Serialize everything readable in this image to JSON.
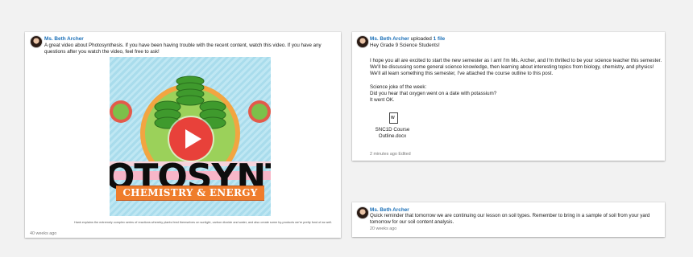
{
  "post_video": {
    "author": "Ms. Beth Archer",
    "body_lines": [
      "A great video about Photosynthesis. If you have been having trouble with the recent content, watch this video. If you have any",
      "questions after you watch the video, feel free to ask!"
    ],
    "thumbnail": {
      "big_word": "OTOSYNTHE",
      "ribbon": "CHEMISTRY & ENERGY"
    },
    "video_caption": "Hank explains the extremely complex series of reactions whereby plants feed themselves on sunlight, carbon dioxide and water, and also create some by-products we're pretty fond of as well.",
    "time": "40 weeks ago"
  },
  "post_file": {
    "author": "Ms. Beth Archer",
    "action": "uploaded",
    "file_count": "1 file",
    "body_lines": [
      "Hey Grade 9 Science Students!",
      "",
      "I hope you all are excited to start the new semester as I am! I'm Ms. Archer, and I'm thrilled to be your science teacher this semester.",
      "We'll be discussing some general science knowledge, then learning about interesting topics from biology, chemistry, and physics!",
      "We'll all learn something this semester, I've attached the course outline to this post.",
      "",
      "Science joke of the week:",
      "Did you hear that oxygen went on a date with potassium?",
      "It went OK."
    ],
    "file_name_line1": "SNC1D Course",
    "file_name_line2": "Outline.docx",
    "time": "2 minutes ago",
    "edited": "Edited"
  },
  "post_reminder": {
    "author": "Ms. Beth Archer",
    "body_lines": [
      "Quick reminder that tomorrow we are continuing our lesson on soil types. Remember to bring in a sample of soil from your yard",
      "tomorrow for our soil content analysis."
    ],
    "time": "20 weeks ago"
  },
  "colors": {
    "link": "#1a6fb7",
    "play_button": "#e8413a",
    "ribbon": "#ef7d2c"
  }
}
